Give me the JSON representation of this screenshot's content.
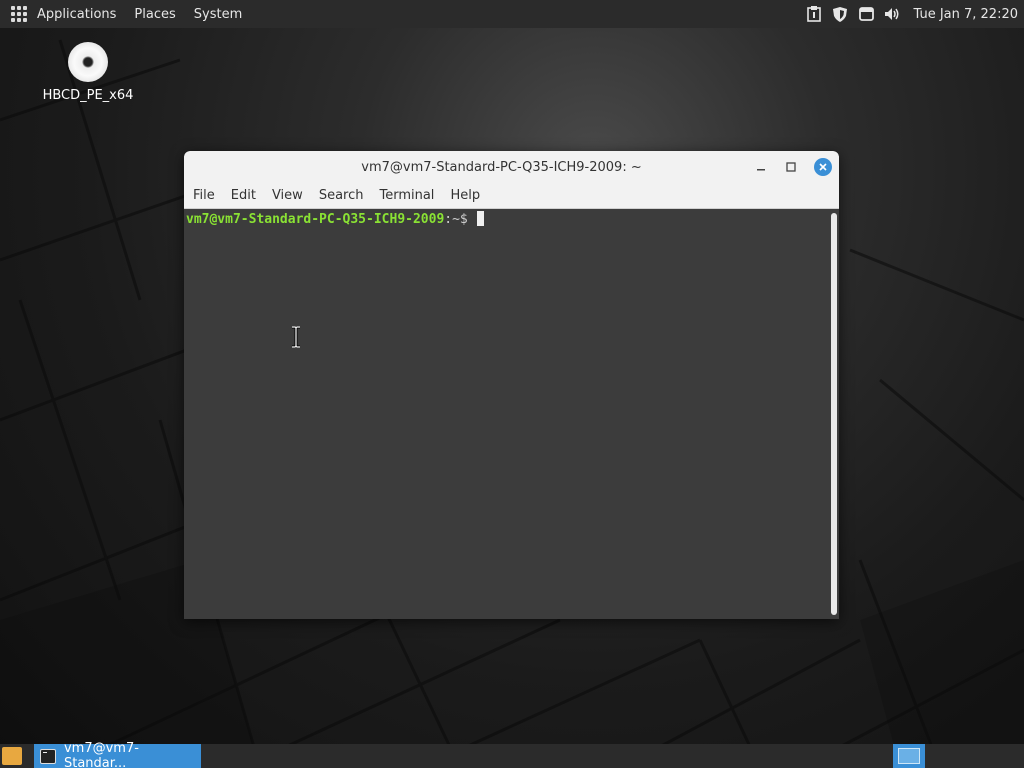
{
  "top_panel": {
    "menus": [
      "Applications",
      "Places",
      "System"
    ],
    "tray_icons": [
      "clipboard-icon",
      "shield-icon",
      "window-icon",
      "volume-icon"
    ],
    "clock": "Tue Jan  7, 22:20"
  },
  "desktop": {
    "icons": [
      {
        "label": "HBCD_PE_x64",
        "icon": "disc-icon"
      }
    ]
  },
  "terminal": {
    "title": "vm7@vm7-Standard-PC-Q35-ICH9-2009: ~",
    "menu": [
      "File",
      "Edit",
      "View",
      "Search",
      "Terminal",
      "Help"
    ],
    "prompt_user": "vm7@vm7-Standard-PC-Q35-ICH9-2009",
    "prompt_path": ":~$ "
  },
  "bottom_panel": {
    "task_label": "vm7@vm7-Standar..."
  },
  "colors": {
    "accent": "#3a8fd6",
    "prompt": "#8ae234",
    "terminal_bg": "#3c3c3c",
    "panel_bg": "#2b2b2b"
  }
}
